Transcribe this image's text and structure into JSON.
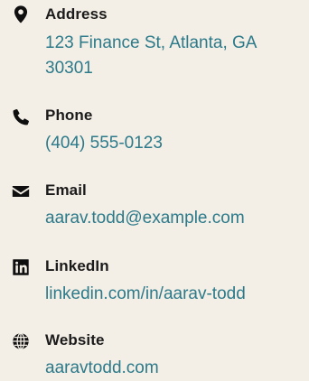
{
  "contact": {
    "address": {
      "label": "Address",
      "value": "123 Finance St, Atlanta, GA 30301",
      "icon": "map-marker-icon"
    },
    "phone": {
      "label": "Phone",
      "value": "(404) 555-0123",
      "icon": "phone-icon"
    },
    "email": {
      "label": "Email",
      "value": "aarav.todd@example.com",
      "icon": "envelope-icon"
    },
    "linkedin": {
      "label": "LinkedIn",
      "value": "linkedin.com/in/aarav-todd",
      "icon": "linkedin-icon"
    },
    "website": {
      "label": "Website",
      "value": "aaravtodd.com",
      "icon": "globe-icon"
    }
  },
  "colors": {
    "background": "#f3eee6",
    "label": "#1b1b1b",
    "link": "#2c7a8a",
    "icon": "#0f0f0f"
  }
}
